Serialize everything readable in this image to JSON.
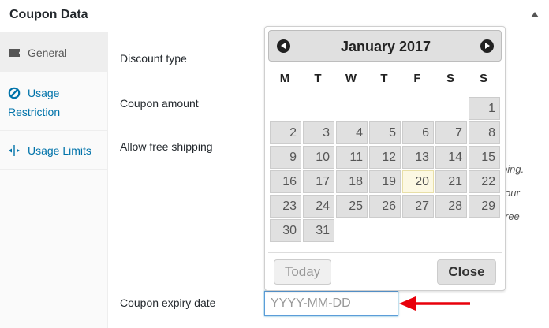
{
  "panel": {
    "title": "Coupon Data"
  },
  "tabs": [
    {
      "label": "General",
      "icon": "ticket-icon"
    },
    {
      "label": "Usage Restriction",
      "icon": "no-entry-icon"
    },
    {
      "label": "Usage Limits",
      "icon": "arrows-icon"
    }
  ],
  "fields": {
    "discount_type": "Discount type",
    "coupon_amount": "Coupon amount",
    "free_shipping": "Allow free shipping",
    "expiry_date": "Coupon expiry date",
    "expiry_placeholder": "YYYY-MM-DD",
    "expiry_value": ""
  },
  "help_fragments": [
    "ping.",
    "our",
    "ree"
  ],
  "datepicker": {
    "title": "January 2017",
    "weekdays": [
      "M",
      "T",
      "W",
      "T",
      "F",
      "S",
      "S"
    ],
    "days": [
      "1",
      "2",
      "3",
      "4",
      "5",
      "6",
      "7",
      "8",
      "9",
      "10",
      "11",
      "12",
      "13",
      "14",
      "15",
      "16",
      "17",
      "18",
      "19",
      "20",
      "21",
      "22",
      "23",
      "24",
      "25",
      "26",
      "27",
      "28",
      "29",
      "30",
      "31"
    ],
    "today": "20",
    "today_label": "Today",
    "close_label": "Close"
  },
  "colors": {
    "accent": "#0073aa",
    "annotation_arrow": "#e8000b",
    "today_highlight": "#fcf8e3"
  }
}
